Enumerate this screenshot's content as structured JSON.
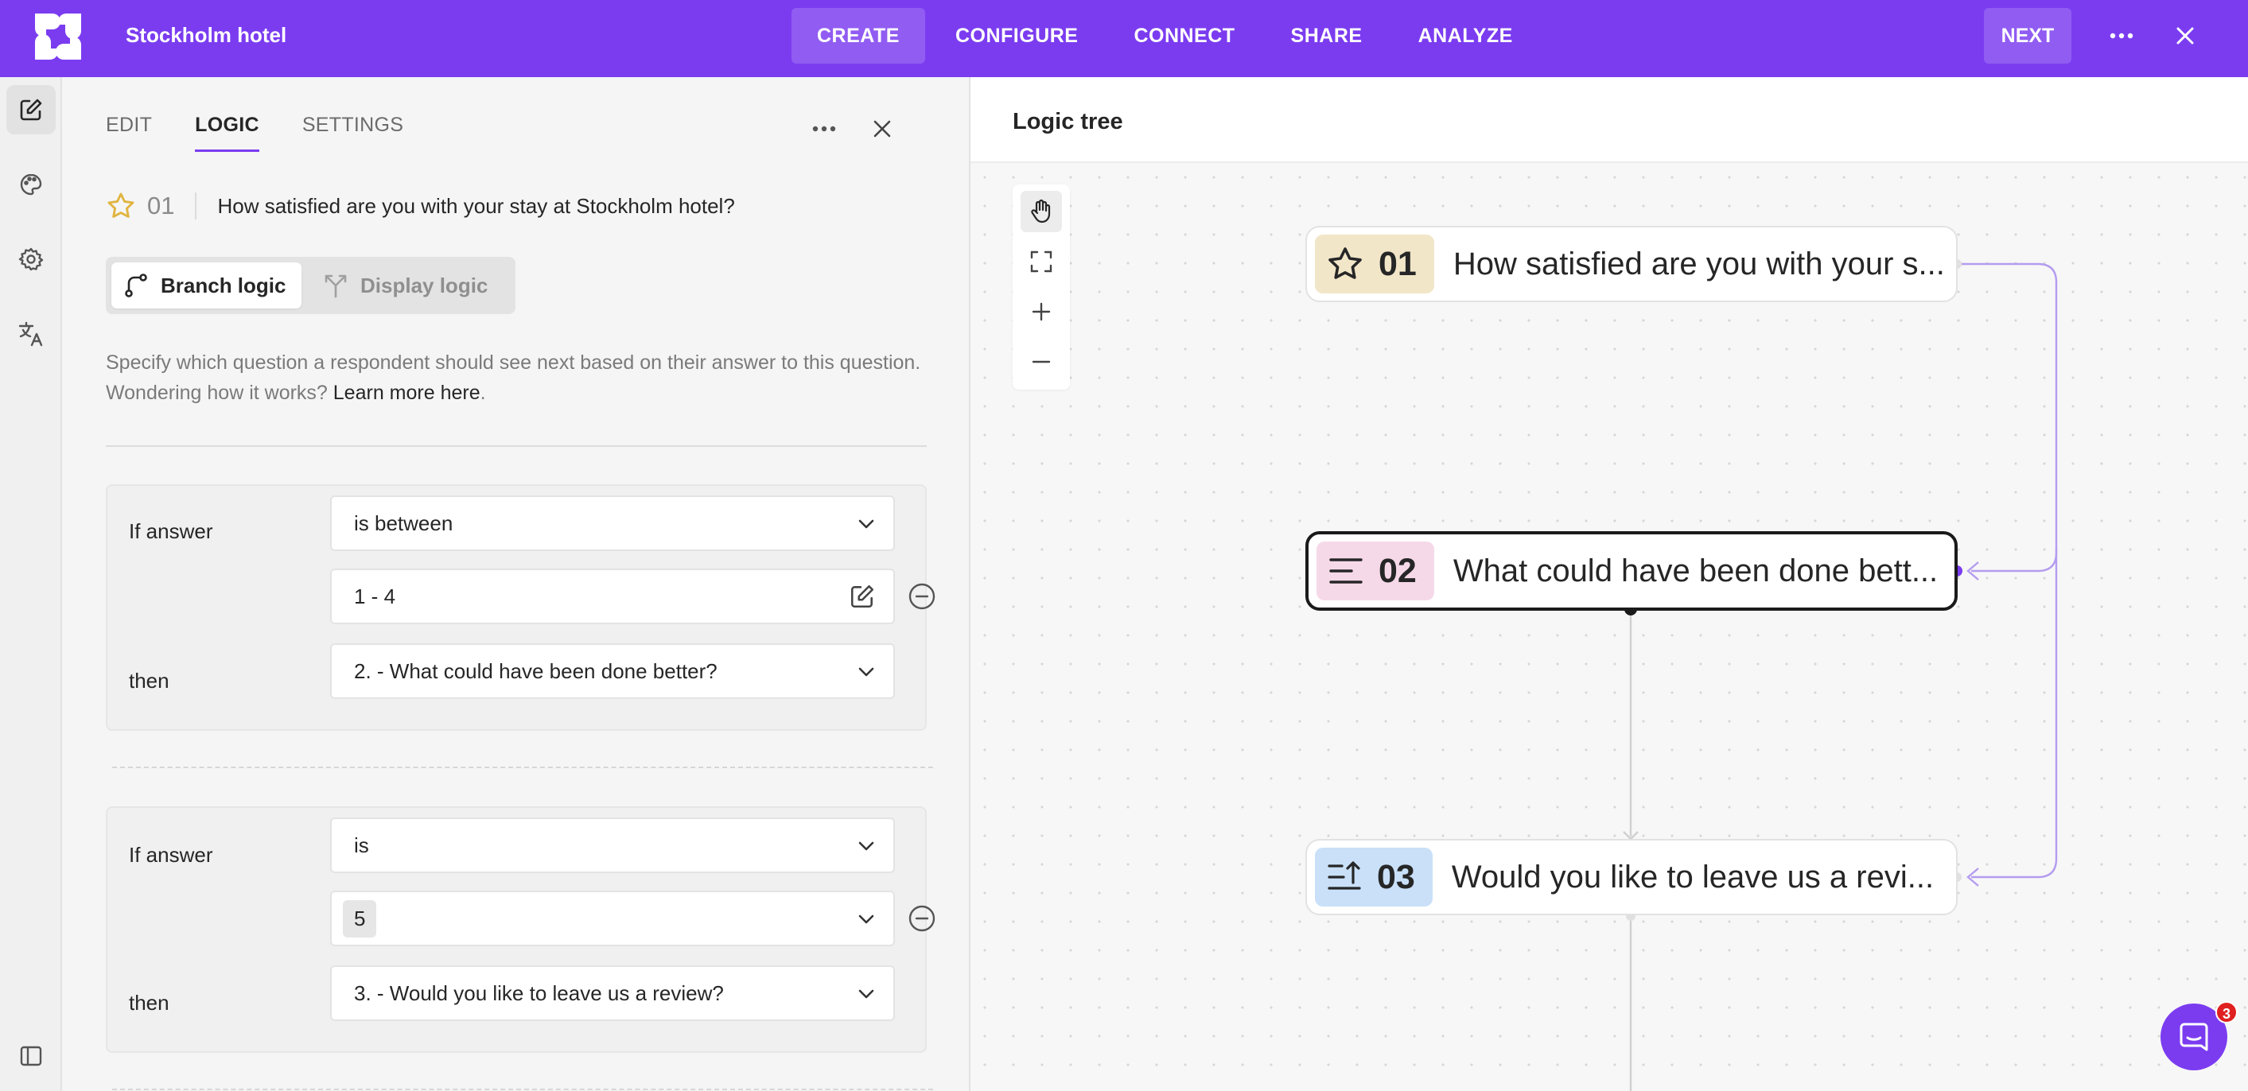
{
  "app": {
    "title": "Stockholm hotel"
  },
  "nav": {
    "items": [
      "CREATE",
      "CONFIGURE",
      "CONNECT",
      "SHARE",
      "ANALYZE"
    ],
    "active": "CREATE",
    "next_label": "NEXT"
  },
  "rail": {
    "icons": [
      "edit-icon",
      "palette-icon",
      "gear-icon",
      "translate-icon",
      "sidebar-toggle-icon"
    ]
  },
  "panel": {
    "tabs": [
      "EDIT",
      "LOGIC",
      "SETTINGS"
    ],
    "active_tab": "LOGIC",
    "question": {
      "number": "01",
      "text": "How satisfied are you with your stay at Stockholm hotel?",
      "icon": "star-icon"
    },
    "logic_modes": {
      "branch": "Branch logic",
      "display": "Display logic",
      "active": "branch"
    },
    "help_text": "Specify which question a respondent should see next based on their answer to this question. Wondering how it works? ",
    "help_link": "Learn more here",
    "help_end": ".",
    "rules": [
      {
        "if_label": "If answer",
        "operator": "is between",
        "value": "1 - 4",
        "then_label": "then",
        "target": "2. - What could have been done better?"
      },
      {
        "if_label": "If answer",
        "operator": "is",
        "value": "5",
        "then_label": "then",
        "target": "3. - Would you like to leave us a review?"
      }
    ]
  },
  "logic_tree": {
    "title": "Logic tree",
    "nodes": [
      {
        "number": "01",
        "text": "How satisfied are you with your s...",
        "icon": "star-icon",
        "badge_color": "#f1e6c8"
      },
      {
        "number": "02",
        "text": "What could have been done bett...",
        "icon": "long-text-icon",
        "badge_color": "#f6d9e8",
        "selected": true
      },
      {
        "number": "03",
        "text": "Would you like to leave us a revi...",
        "icon": "sort-icon",
        "badge_color": "#c9e0f8"
      }
    ]
  },
  "colors": {
    "brand": "#7b3cf0",
    "edge": "#b49cf0"
  },
  "chat": {
    "badge_count": "3"
  }
}
